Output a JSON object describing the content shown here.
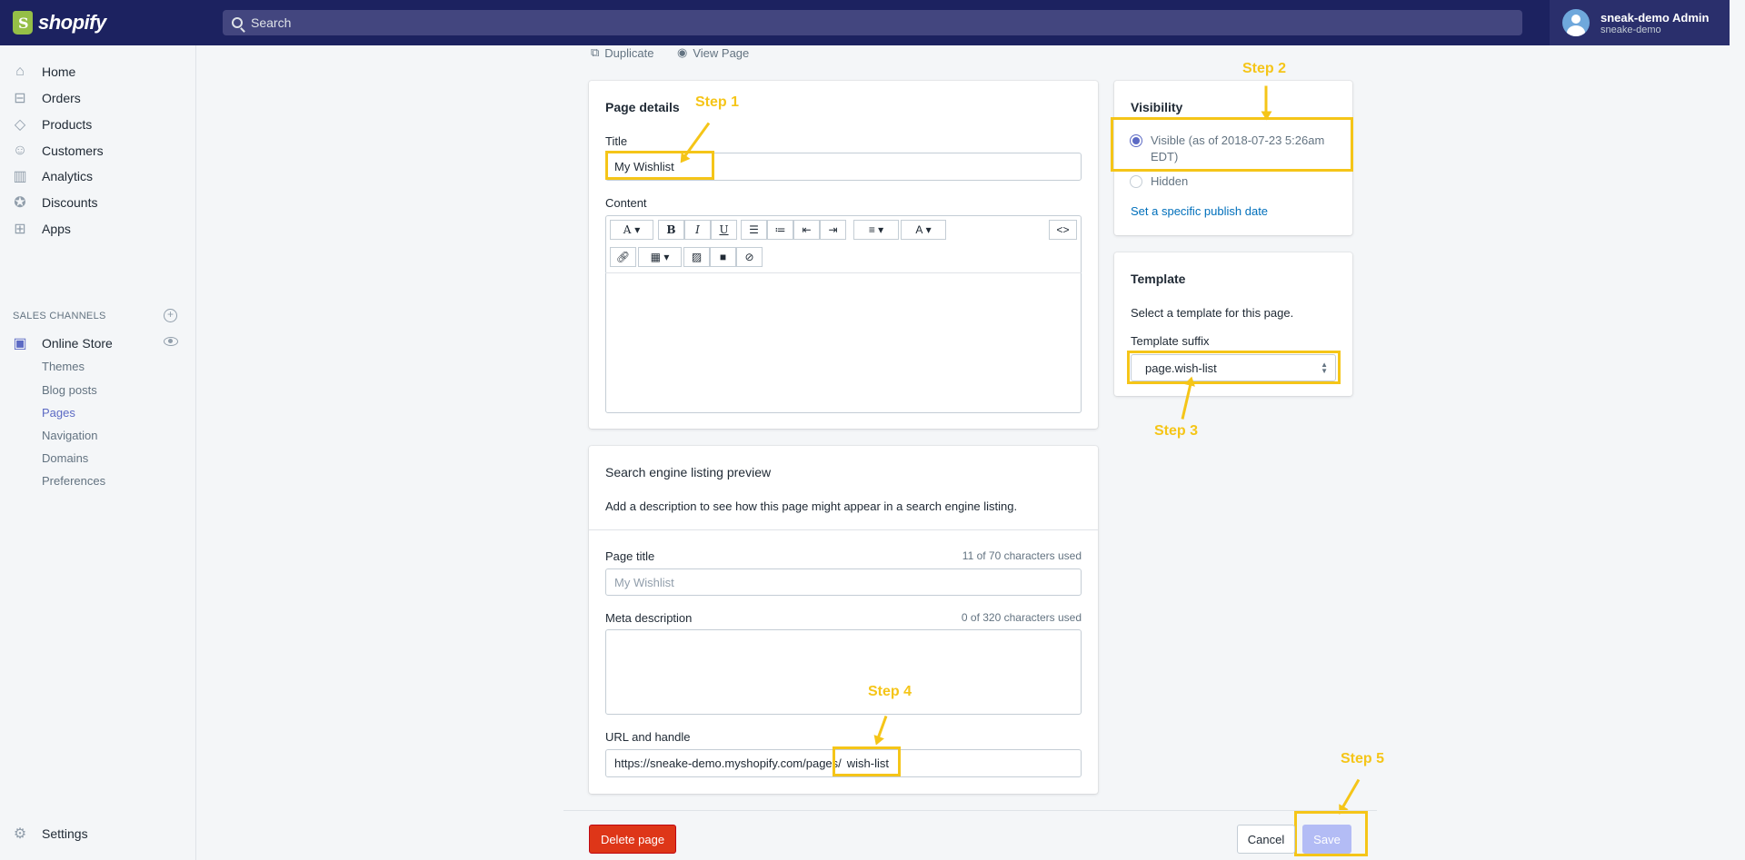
{
  "topbar": {
    "logo_text": "shopify",
    "search_placeholder": "Search",
    "user_name": "sneak-demo Admin",
    "user_store": "sneake-demo"
  },
  "sidebar": {
    "items": [
      {
        "label": "Home",
        "icon": "home-icon"
      },
      {
        "label": "Orders",
        "icon": "orders-icon"
      },
      {
        "label": "Products",
        "icon": "tag-icon"
      },
      {
        "label": "Customers",
        "icon": "person-icon"
      },
      {
        "label": "Analytics",
        "icon": "bar-chart-icon"
      },
      {
        "label": "Discounts",
        "icon": "discount-icon"
      },
      {
        "label": "Apps",
        "icon": "apps-icon"
      }
    ],
    "sales_channels_title": "SALES CHANNELS",
    "online_store": "Online Store",
    "sub_items": [
      "Themes",
      "Blog posts",
      "Pages",
      "Navigation",
      "Domains",
      "Preferences"
    ],
    "settings": "Settings"
  },
  "actions": {
    "duplicate": "Duplicate",
    "view_page": "View Page"
  },
  "page_details": {
    "title": "Page details",
    "title_label": "Title",
    "title_value": "My Wishlist",
    "content_label": "Content"
  },
  "toolbar": {
    "font": "A",
    "bold": "B",
    "italic": "I",
    "underline": "U",
    "align": "≡",
    "color": "A",
    "html": "<>"
  },
  "seo": {
    "title": "Search engine listing preview",
    "description": "Add a description to see how this page might appear in a search engine listing.",
    "page_title_label": "Page title",
    "page_title_count": "11 of 70 characters used",
    "page_title_placeholder": "My Wishlist",
    "meta_label": "Meta description",
    "meta_count": "0 of 320 characters used",
    "url_label": "URL and handle",
    "url_prefix": "https://sneake-demo.myshopify.com/pages/",
    "url_handle": "wish-list"
  },
  "visibility": {
    "title": "Visibility",
    "visible_label": "Visible (as of 2018-07-23 5:26am",
    "visible_label_2": "EDT)",
    "hidden_label": "Hidden",
    "publish_link": "Set a specific publish date"
  },
  "template": {
    "title": "Template",
    "description": "Select a template for this page.",
    "suffix_label": "Template suffix",
    "suffix_value": "page.wish-list"
  },
  "steps": {
    "step1": "Step 1",
    "step2": "Step 2",
    "step3": "Step 3",
    "step4": "Step 4",
    "step5": "Step 5"
  },
  "footer": {
    "delete": "Delete page",
    "cancel": "Cancel",
    "save": "Save"
  },
  "colors": {
    "topbar": "#1c2260",
    "accent": "#5c6ac4",
    "highlight": "#f5c518",
    "danger": "#de3618"
  }
}
